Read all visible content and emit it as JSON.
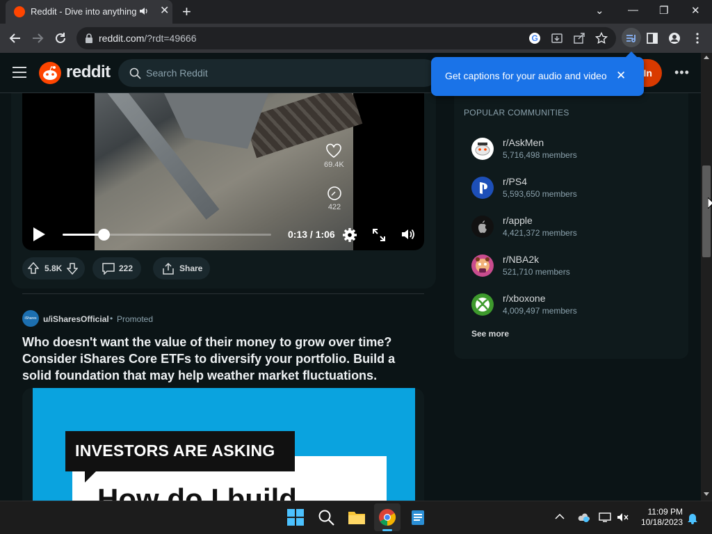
{
  "browser": {
    "tab_title": "Reddit - Dive into anything",
    "url_domain": "reddit.com",
    "url_path": "/?rdt=49666"
  },
  "header": {
    "logo_text": "reddit",
    "search_placeholder": "Search Reddit",
    "login_label": "In"
  },
  "captions_popup": {
    "message": "Get captions for your audio and video"
  },
  "video_post": {
    "overlay_likes": "69.4K",
    "overlay_comments": "422",
    "timecode": "0:13 / 1:06",
    "progress_fraction": 0.197,
    "upvotes": "5.8K",
    "comments": "222",
    "share_label": "Share"
  },
  "ad_post": {
    "avatar_text": "iShares",
    "username": "u/iSharesOfficial",
    "separator": "•",
    "promoted_label": "Promoted",
    "title": "Who doesn't want the value of their money to grow over time? Consider iShares Core ETFs to diversify your portfolio. Build a solid foundation that may help weather market fluctuations.",
    "banner_text": "INVESTORS ARE ASKING",
    "banner_subtext": "How do I build"
  },
  "sidebar": {
    "heading": "POPULAR COMMUNITIES",
    "communities": [
      {
        "name": "r/AskMen",
        "members": "5,716,498 members",
        "color": "#ffffff"
      },
      {
        "name": "r/PS4",
        "members": "5,593,650 members",
        "color": "#1d4fb8"
      },
      {
        "name": "r/apple",
        "members": "4,421,372 members",
        "color": "#111111"
      },
      {
        "name": "r/NBA2k",
        "members": "521,710 members",
        "color": "#c94c8e"
      },
      {
        "name": "r/xboxone",
        "members": "4,009,497 members",
        "color": "#3e9a2d"
      }
    ],
    "see_more": "See more"
  },
  "taskbar": {
    "time": "11:09 PM",
    "date": "10/18/2023"
  },
  "colors": {
    "reddit_orange": "#ff4500",
    "chrome_blue": "#1a73e8"
  }
}
